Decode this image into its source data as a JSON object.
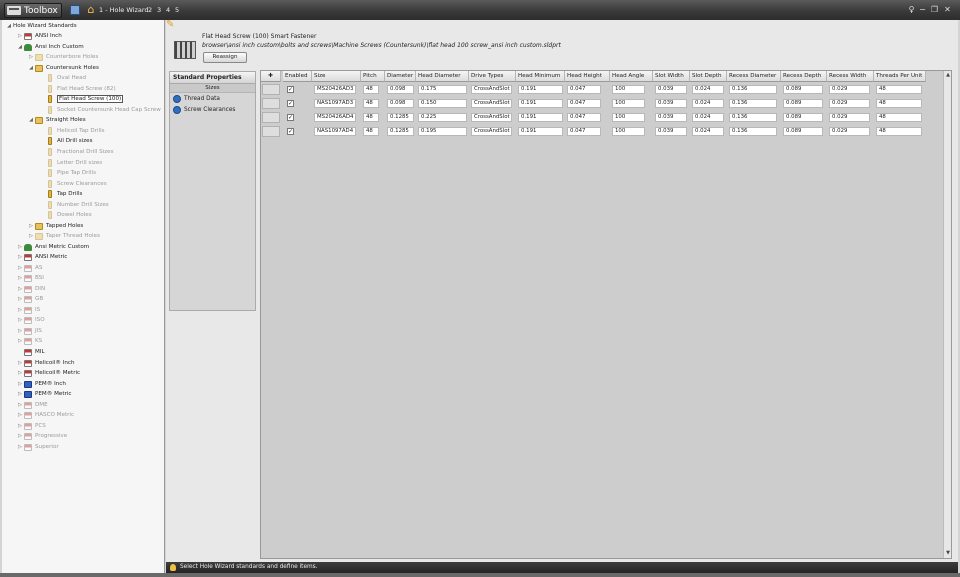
{
  "titlebar": {
    "app_label": "Toolbox",
    "breadcrumb": [
      "1 - Hole Wizard",
      "2",
      "3",
      "4",
      "5"
    ],
    "right_icons": [
      "pin-icon",
      "minimize-icon",
      "restore-icon",
      "close-icon"
    ],
    "colors": {
      "bar": "#3a3a3a",
      "text": "#f0f0f0"
    }
  },
  "tree": [
    {
      "label": "Hole Wizard Standards",
      "level": 0,
      "expander": "expanded",
      "icon": "",
      "dim": false,
      "selected": false
    },
    {
      "label": "ANSI Inch",
      "level": 1,
      "expander": "collapsed",
      "icon": "flag",
      "dim": false,
      "selected": false
    },
    {
      "label": "Ansi Inch Custom",
      "level": 1,
      "expander": "expanded",
      "icon": "user",
      "dim": false,
      "selected": false
    },
    {
      "label": "Counterbore Holes",
      "level": 2,
      "expander": "collapsed",
      "icon": "folder",
      "dim": true,
      "selected": false
    },
    {
      "label": "Countersunk Holes",
      "level": 2,
      "expander": "expanded",
      "icon": "folder",
      "dim": false,
      "selected": false
    },
    {
      "label": "Oval Head",
      "level": 3,
      "expander": "",
      "icon": "hole",
      "dim": true,
      "selected": false
    },
    {
      "label": "Flat Head Screw (82)",
      "level": 3,
      "expander": "",
      "icon": "hole",
      "dim": true,
      "selected": false
    },
    {
      "label": "Flat Head Screw (100)",
      "level": 3,
      "expander": "",
      "icon": "hole",
      "dim": false,
      "selected": true
    },
    {
      "label": "Socket Countersunk Head Cap Screw",
      "level": 3,
      "expander": "",
      "icon": "hole",
      "dim": true,
      "selected": false
    },
    {
      "label": "Straight Holes",
      "level": 2,
      "expander": "expanded",
      "icon": "folder",
      "dim": false,
      "selected": false
    },
    {
      "label": "Helicoil Tap Drills",
      "level": 3,
      "expander": "",
      "icon": "hole",
      "dim": true,
      "selected": false
    },
    {
      "label": "All Drill sizes",
      "level": 3,
      "expander": "",
      "icon": "hole",
      "dim": false,
      "selected": false
    },
    {
      "label": "Fractional Drill Sizes",
      "level": 3,
      "expander": "",
      "icon": "hole",
      "dim": true,
      "selected": false
    },
    {
      "label": "Letter Drill sizes",
      "level": 3,
      "expander": "",
      "icon": "hole",
      "dim": true,
      "selected": false
    },
    {
      "label": "Pipe Tap Drills",
      "level": 3,
      "expander": "",
      "icon": "hole",
      "dim": true,
      "selected": false
    },
    {
      "label": "Screw Clearances",
      "level": 3,
      "expander": "",
      "icon": "hole",
      "dim": true,
      "selected": false
    },
    {
      "label": "Tap Drills",
      "level": 3,
      "expander": "",
      "icon": "hole",
      "dim": false,
      "selected": false
    },
    {
      "label": "Number Drill Sizes",
      "level": 3,
      "expander": "",
      "icon": "hole",
      "dim": true,
      "selected": false
    },
    {
      "label": "Dowel Holes",
      "level": 3,
      "expander": "",
      "icon": "hole",
      "dim": true,
      "selected": false
    },
    {
      "label": "Tapped Holes",
      "level": 2,
      "expander": "collapsed",
      "icon": "folder",
      "dim": false,
      "selected": false
    },
    {
      "label": "Taper Thread Holes",
      "level": 2,
      "expander": "collapsed",
      "icon": "folder",
      "dim": true,
      "selected": false
    },
    {
      "label": "Ansi Metric Custom",
      "level": 1,
      "expander": "collapsed",
      "icon": "user",
      "dim": false,
      "selected": false
    },
    {
      "label": "ANSI Metric",
      "level": 1,
      "expander": "collapsed",
      "icon": "flag",
      "dim": false,
      "selected": false
    },
    {
      "label": "AS",
      "level": 1,
      "expander": "collapsed",
      "icon": "flag",
      "dim": true,
      "selected": false
    },
    {
      "label": "BSI",
      "level": 1,
      "expander": "collapsed",
      "icon": "flag",
      "dim": true,
      "selected": false
    },
    {
      "label": "DIN",
      "level": 1,
      "expander": "collapsed",
      "icon": "flag",
      "dim": true,
      "selected": false
    },
    {
      "label": "GB",
      "level": 1,
      "expander": "collapsed",
      "icon": "flag",
      "dim": true,
      "selected": false
    },
    {
      "label": "IS",
      "level": 1,
      "expander": "collapsed",
      "icon": "flag",
      "dim": true,
      "selected": false
    },
    {
      "label": "ISO",
      "level": 1,
      "expander": "collapsed",
      "icon": "flag",
      "dim": true,
      "selected": false
    },
    {
      "label": "JIS",
      "level": 1,
      "expander": "collapsed",
      "icon": "flag",
      "dim": true,
      "selected": false
    },
    {
      "label": "KS",
      "level": 1,
      "expander": "collapsed",
      "icon": "flag",
      "dim": true,
      "selected": false
    },
    {
      "label": "MIL",
      "level": 1,
      "expander": "",
      "icon": "flag",
      "dim": false,
      "selected": false
    },
    {
      "label": "Helicoil® Inch",
      "level": 1,
      "expander": "collapsed",
      "icon": "flag",
      "dim": false,
      "selected": false
    },
    {
      "label": "Helicoil® Metric",
      "level": 1,
      "expander": "collapsed",
      "icon": "flag",
      "dim": false,
      "selected": false
    },
    {
      "label": "PEM® Inch",
      "level": 1,
      "expander": "collapsed",
      "icon": "pem",
      "dim": false,
      "selected": false
    },
    {
      "label": "PEM® Metric",
      "level": 1,
      "expander": "collapsed",
      "icon": "pem",
      "dim": false,
      "selected": false
    },
    {
      "label": "DME",
      "level": 1,
      "expander": "collapsed",
      "icon": "flag",
      "dim": true,
      "selected": false
    },
    {
      "label": "HASCO Metric",
      "level": 1,
      "expander": "collapsed",
      "icon": "flag",
      "dim": true,
      "selected": false
    },
    {
      "label": "PCS",
      "level": 1,
      "expander": "collapsed",
      "icon": "flag",
      "dim": true,
      "selected": false
    },
    {
      "label": "Progressive",
      "level": 1,
      "expander": "collapsed",
      "icon": "flag",
      "dim": true,
      "selected": false
    },
    {
      "label": "Superior",
      "level": 1,
      "expander": "collapsed",
      "icon": "flag",
      "dim": true,
      "selected": false
    }
  ],
  "header": {
    "title": "Flat Head Screw (100) Smart Fastener",
    "path": "browser\\ansi inch custom\\bolts and screws\\Machine Screws (Countersunk)\\flat head 100 screw_ansi inch custom.sldprt",
    "reassign_label": "Reassign"
  },
  "properties": {
    "title": "Standard Properties",
    "subtitle": "Sizes",
    "items": [
      {
        "label": "Thread Data",
        "icon": "thread-data-icon"
      },
      {
        "label": "Screw Clearances",
        "icon": "screw-clearances-icon"
      }
    ]
  },
  "table": {
    "columns": [
      "Enabled",
      "Size",
      "Pitch",
      "Diameter",
      "Head Diameter",
      "Drive Types",
      "Head Minimum",
      "Head Height",
      "Head Angle",
      "Slot Width",
      "Slot Depth",
      "Recess Diameter",
      "Recess Depth",
      "Recess Width",
      "Threads Per Unit"
    ],
    "rows": [
      {
        "enabled": true,
        "cells": [
          "MS20426AD3",
          "48",
          "0.098",
          "0.175",
          "CrossAndSlot",
          "0.191",
          "0.047",
          "100",
          "0.039",
          "0.024",
          "0.136",
          "0.089",
          "0.029",
          "48"
        ]
      },
      {
        "enabled": true,
        "cells": [
          "NAS1097AD3",
          "48",
          "0.098",
          "0.150",
          "CrossAndSlot",
          "0.191",
          "0.047",
          "100",
          "0.039",
          "0.024",
          "0.136",
          "0.089",
          "0.029",
          "48"
        ]
      },
      {
        "enabled": true,
        "cells": [
          "MS20426AD4",
          "48",
          "0.1285",
          "0.225",
          "CrossAndSlot",
          "0.191",
          "0.047",
          "100",
          "0.039",
          "0.024",
          "0.136",
          "0.089",
          "0.029",
          "48"
        ]
      },
      {
        "enabled": true,
        "cells": [
          "NAS1097AD4",
          "48",
          "0.1285",
          "0.195",
          "CrossAndSlot",
          "0.191",
          "0.047",
          "100",
          "0.039",
          "0.024",
          "0.136",
          "0.089",
          "0.029",
          "48"
        ]
      }
    ]
  },
  "status": {
    "text": "Select Hole Wizard standards and define items."
  }
}
